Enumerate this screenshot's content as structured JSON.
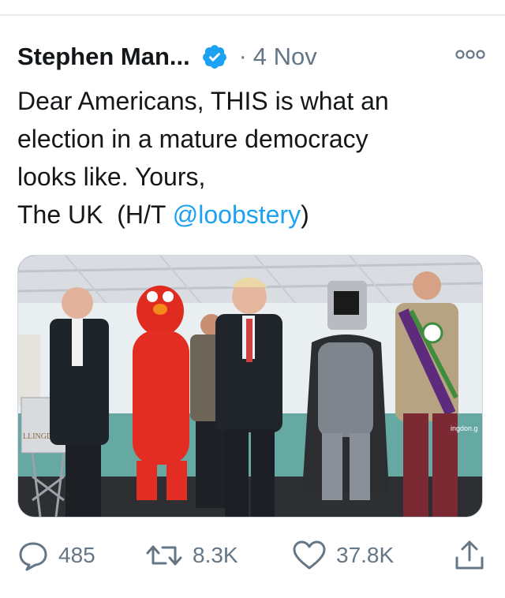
{
  "tweet": {
    "author": "Stephen Man...",
    "separator": "·",
    "date": "4 Nov",
    "text_line1": "Dear Americans, THIS is what an",
    "text_line2": "election in a mature democracy",
    "text_line3": "looks like. Yours,",
    "text_line4_prefix": "The UK  (H/T ",
    "mention": "@loobstery",
    "text_line4_suffix": ")"
  },
  "photo": {
    "lectern_sign": "LLINGDON",
    "backdrop_right": "ingdon.g"
  },
  "actions": {
    "replies": "485",
    "retweets": "8.3K",
    "likes": "37.8K"
  },
  "icons": [
    "verified-badge-icon",
    "more-options-icon",
    "reply-icon",
    "retweet-icon",
    "like-icon",
    "share-icon"
  ],
  "colors": {
    "accent": "#1da1f2",
    "secondary_text": "#657786",
    "primary_text": "#14171a"
  }
}
